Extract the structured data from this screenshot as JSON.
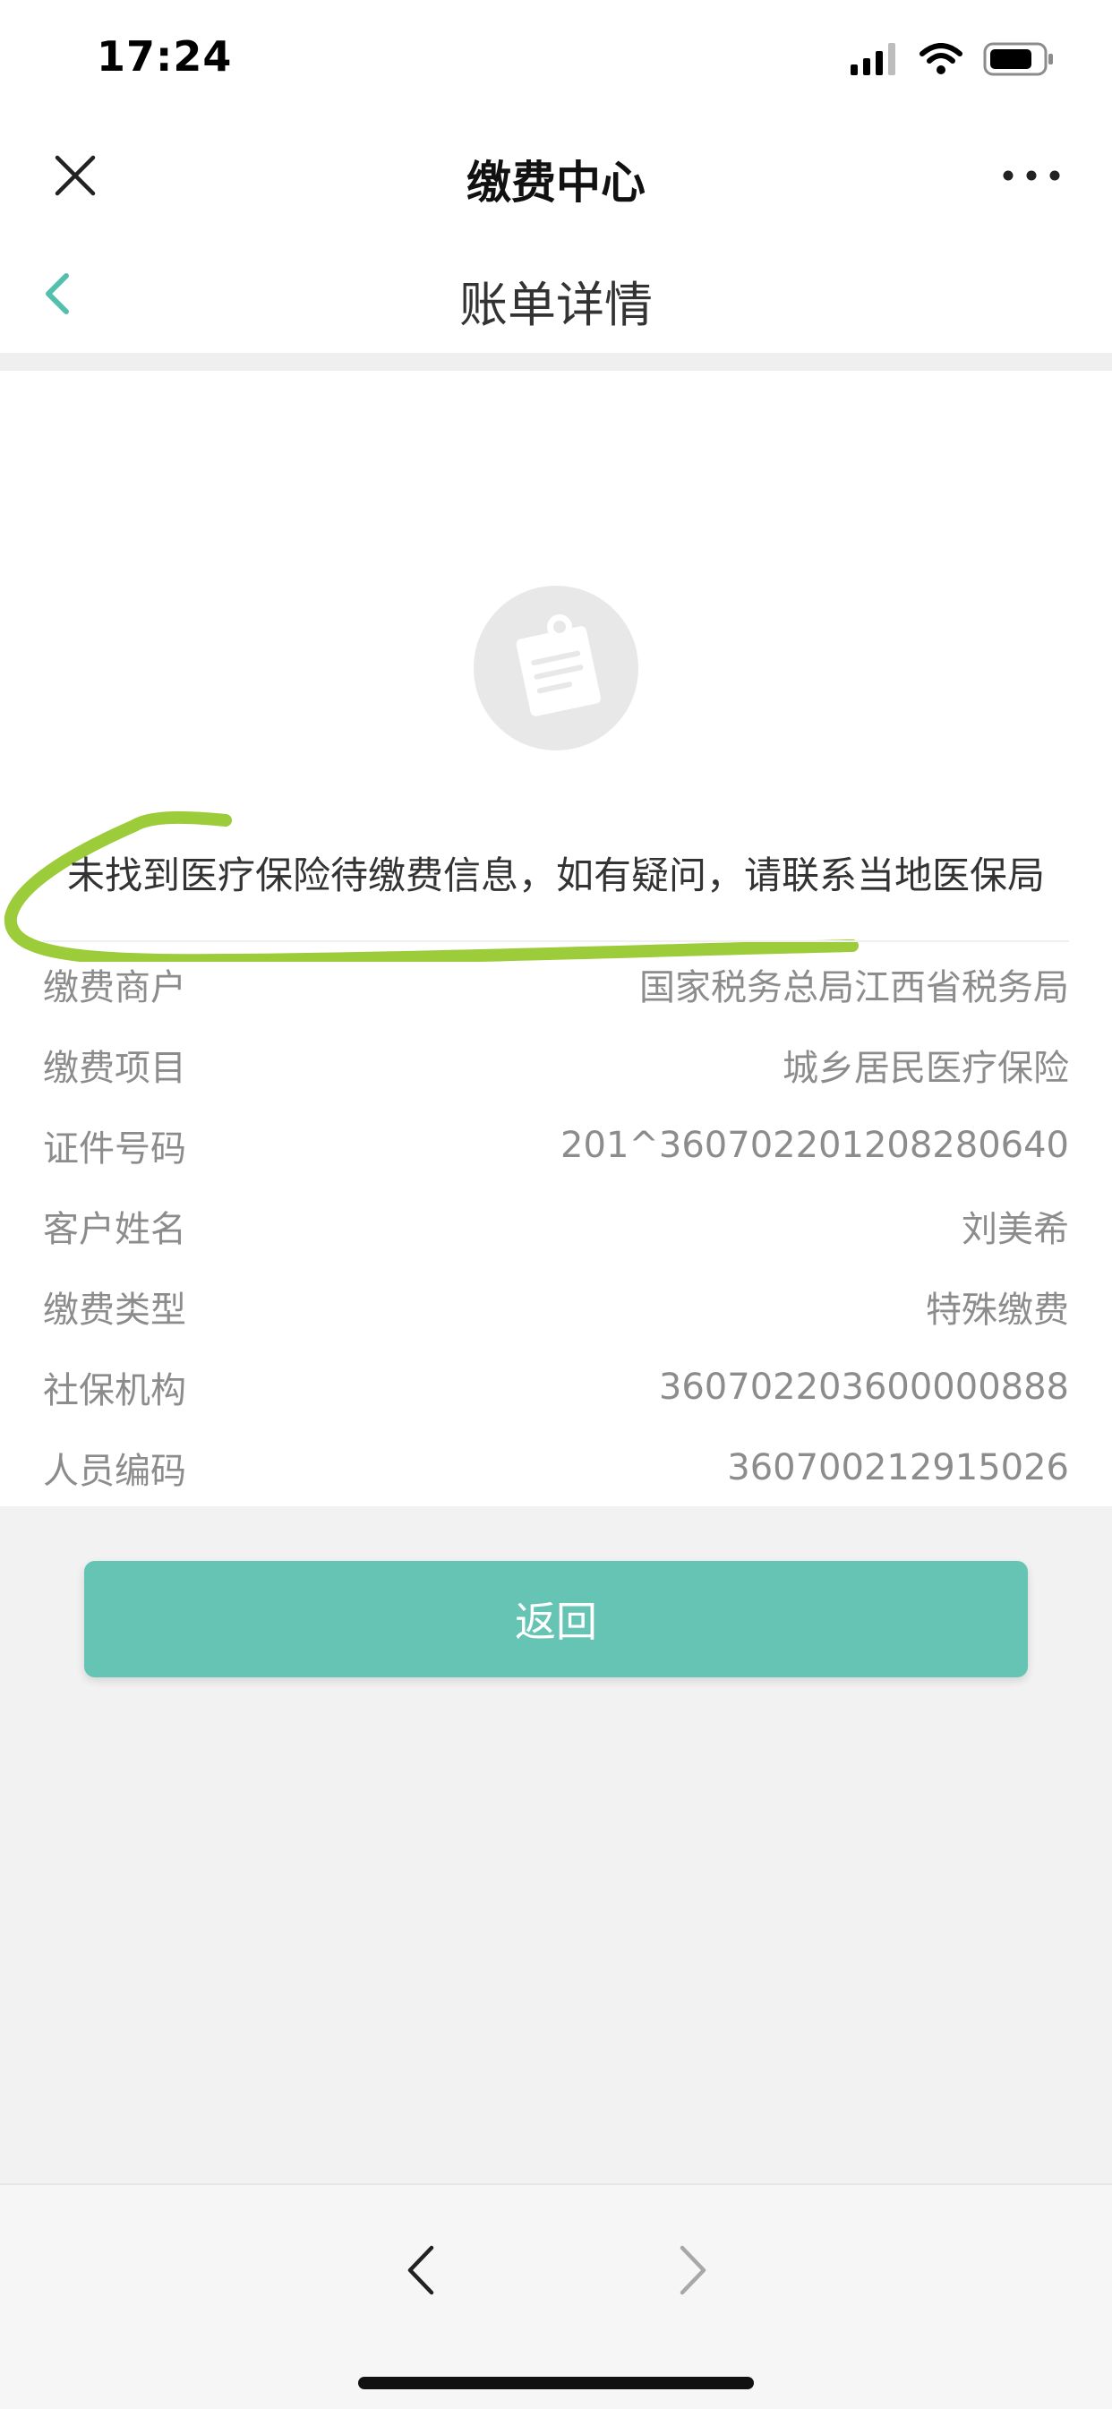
{
  "status_bar": {
    "time": "17:24",
    "icons": [
      "signal-icon",
      "wifi-icon",
      "battery-icon"
    ]
  },
  "header": {
    "title": "缴费中心",
    "close_icon": "close-icon",
    "more_icon": "more-icon"
  },
  "sub_header": {
    "title": "账单详情",
    "back_icon": "chevron-left-icon"
  },
  "main": {
    "empty_icon": "bill-document-icon",
    "message": "未找到医疗保险待缴费信息，如有疑问，请联系当地医保局",
    "info_rows": [
      {
        "label": "缴费商户",
        "value": "国家税务总局江西省税务局"
      },
      {
        "label": "缴费项目",
        "value": "城乡居民医疗保险"
      },
      {
        "label": "证件号码",
        "value": "201^360702201208280640"
      },
      {
        "label": "客户姓名",
        "value": "刘美希"
      },
      {
        "label": "缴费类型",
        "value": "特殊缴费"
      },
      {
        "label": "社保机构",
        "value": "360702203600000888"
      },
      {
        "label": "人员编码",
        "value": "360700212915026"
      }
    ]
  },
  "actions": {
    "return_label": "返回"
  },
  "bottom_nav": {
    "back_icon": "chevron-left-icon",
    "forward_icon": "chevron-right-icon"
  },
  "colors": {
    "accent": "#66c4b5",
    "annotation": "#9ccc3a",
    "text_muted": "#8c8c8c",
    "background": "#f2f2f2"
  }
}
